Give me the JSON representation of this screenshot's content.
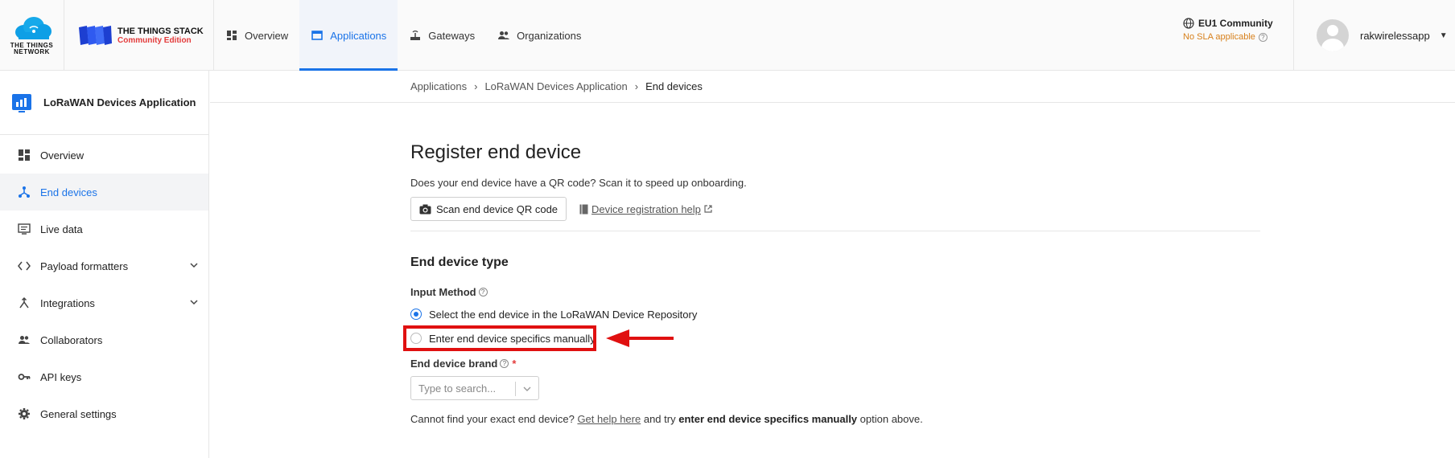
{
  "header": {
    "ttn_logo_text": [
      "THE THINGS",
      "NETWORK"
    ],
    "stack_name": "THE THINGS STACK",
    "stack_edition": "Community Edition",
    "nav": [
      {
        "label": "Overview",
        "icon": "dashboard-icon",
        "active": false
      },
      {
        "label": "Applications",
        "icon": "window-icon",
        "active": true
      },
      {
        "label": "Gateways",
        "icon": "gateway-icon",
        "active": false
      },
      {
        "label": "Organizations",
        "icon": "people-icon",
        "active": false
      }
    ],
    "cluster_name": "EU1 Community",
    "sla_text": "No SLA applicable",
    "username": "rakwirelessapp"
  },
  "sidebar": {
    "app_title": "LoRaWAN Devices Application",
    "items": [
      {
        "label": "Overview",
        "icon": "dashboard-icon",
        "active": false
      },
      {
        "label": "End devices",
        "icon": "devices-icon",
        "active": true
      },
      {
        "label": "Live data",
        "icon": "live-data-icon",
        "active": false
      },
      {
        "label": "Payload formatters",
        "icon": "code-icon",
        "active": false,
        "expandable": true
      },
      {
        "label": "Integrations",
        "icon": "merge-icon",
        "active": false,
        "expandable": true
      },
      {
        "label": "Collaborators",
        "icon": "people-icon",
        "active": false
      },
      {
        "label": "API keys",
        "icon": "key-icon",
        "active": false
      },
      {
        "label": "General settings",
        "icon": "gear-icon",
        "active": false
      }
    ]
  },
  "breadcrumb": [
    "Applications",
    "LoRaWAN Devices Application",
    "End devices"
  ],
  "main": {
    "title": "Register end device",
    "qr_prompt": "Does your end device have a QR code? Scan it to speed up onboarding.",
    "scan_button": "Scan end device QR code",
    "help_link": "Device registration help",
    "section_title": "End device type",
    "input_method_label": "Input Method",
    "options": [
      {
        "label": "Select the end device in the LoRaWAN Device Repository",
        "checked": true
      },
      {
        "label": "Enter end device specifics manually",
        "checked": false
      }
    ],
    "brand_label": "End device brand",
    "brand_placeholder": "Type to search...",
    "cannot_find_prefix": "Cannot find your exact end device?",
    "cannot_find_link": "Get help here",
    "cannot_find_middle": "and try",
    "cannot_find_bold": "enter end device specifics manually",
    "cannot_find_suffix": "option above."
  },
  "colors": {
    "accent": "#1a73e8",
    "highlight": "#e01010",
    "sla": "#d7801c",
    "required": "#e33b3b"
  }
}
